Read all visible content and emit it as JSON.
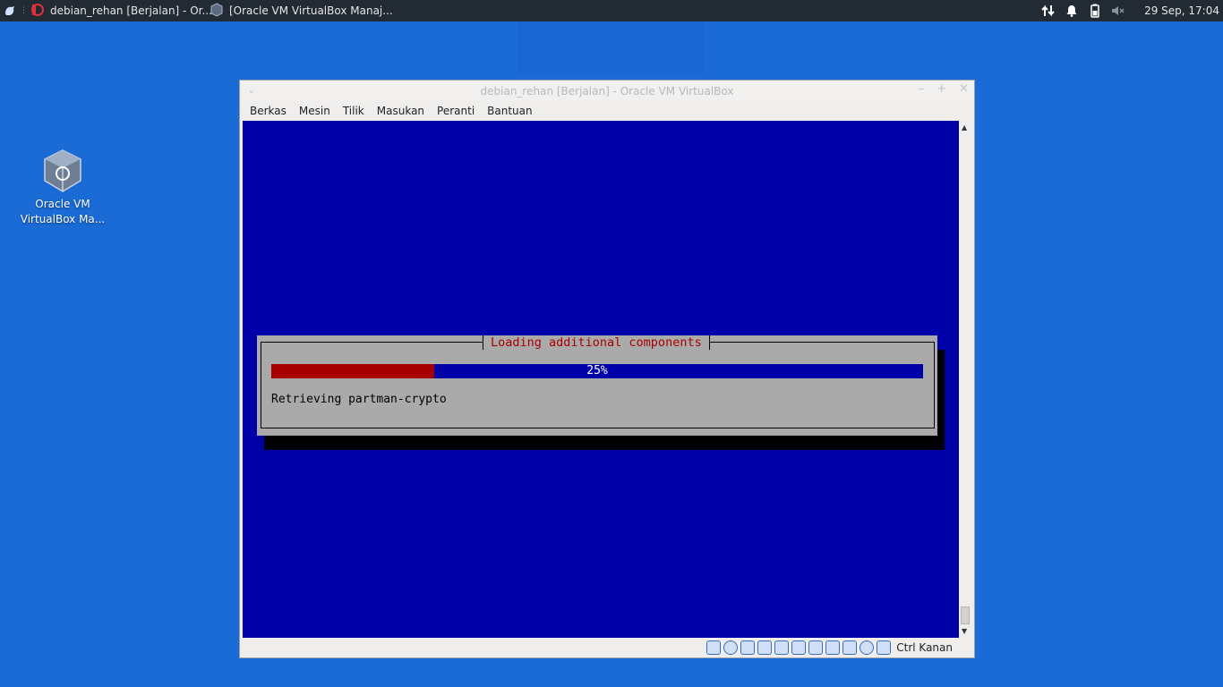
{
  "panel": {
    "tasks": [
      {
        "label": "debian_rehan [Berjalan] - Or...",
        "icon": "virtualbox-vm-icon"
      },
      {
        "label": "[Oracle VM VirtualBox Manaj...",
        "icon": "virtualbox-icon"
      }
    ],
    "clock": "29 Sep, 17:04"
  },
  "desktop": {
    "icon_label_line1": "Oracle VM",
    "icon_label_line2": "VirtualBox Ma..."
  },
  "window": {
    "title": "debian_rehan [Berjalan] - Oracle VM VirtualBox",
    "menu": [
      "Berkas",
      "Mesin",
      "Tilik",
      "Masukan",
      "Peranti",
      "Bantuan"
    ],
    "status_text": "Ctrl Kanan"
  },
  "installer": {
    "title": "Loading additional components",
    "progress_fraction": 0.25,
    "progress_label": "25%",
    "message": "Retrieving partman-crypto"
  },
  "colors": {
    "desktop": "#1a6bd6",
    "vm_background": "#0000a8",
    "dialog_background": "#aaaaaa",
    "accent_red": "#a80000"
  }
}
